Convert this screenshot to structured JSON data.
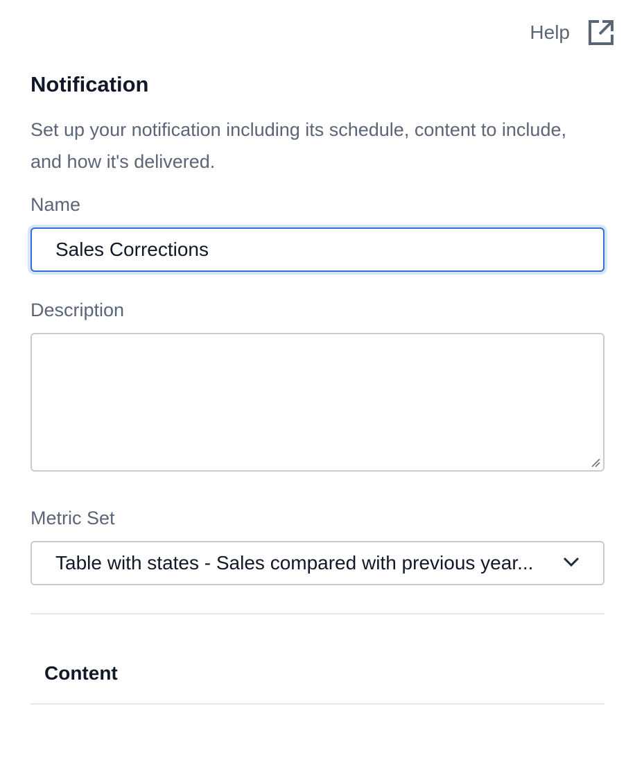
{
  "header": {
    "help_label": "Help",
    "help_icon": "external-link-icon"
  },
  "panel": {
    "title": "Notification",
    "intro": "Set up your notification including its schedule, content to include, and how it's delivered."
  },
  "form": {
    "name_label": "Name",
    "name_value": "Sales Corrections",
    "description_label": "Description",
    "description_value": "",
    "metric_set_label": "Metric Set",
    "metric_set_value": "Table with states - Sales compared with previous year...",
    "metric_set_icon": "chevron-down-icon"
  },
  "sections": {
    "content_title": "Content"
  },
  "colors": {
    "focus_accent": "#2f6fd0",
    "muted_text": "#5b6577",
    "heading_text": "#111827"
  }
}
